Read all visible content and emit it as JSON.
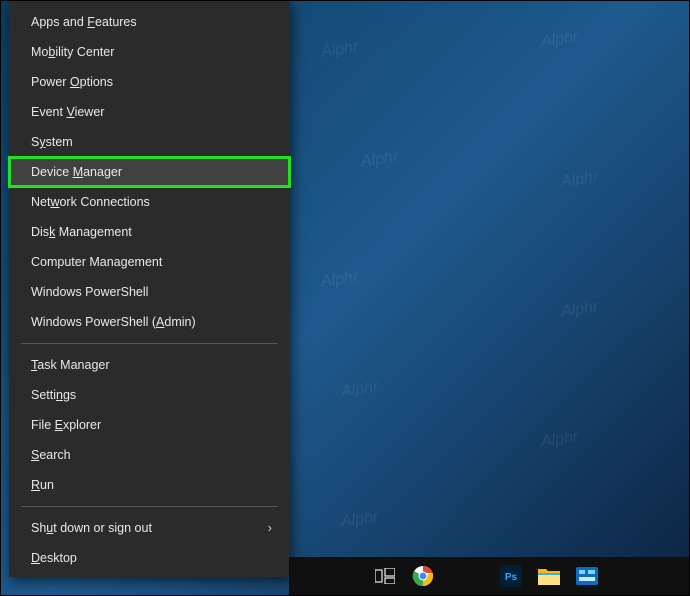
{
  "menu": {
    "items": [
      {
        "label": "Apps and Features",
        "underline": "F"
      },
      {
        "label": "Mobility Center",
        "underline": "b"
      },
      {
        "label": "Power Options",
        "underline": "O"
      },
      {
        "label": "Event Viewer",
        "underline": "V"
      },
      {
        "label": "System",
        "underline": "Y"
      },
      {
        "label": "Device Manager",
        "underline": "M",
        "highlighted": true,
        "hovered": true
      },
      {
        "label": "Network Connections",
        "underline": "W"
      },
      {
        "label": "Disk Management",
        "underline": "k"
      },
      {
        "label": "Computer Management",
        "underline": "G"
      },
      {
        "label": "Windows PowerShell",
        "underline": ""
      },
      {
        "label": "Windows PowerShell (Admin)",
        "underline": "A"
      }
    ],
    "items2": [
      {
        "label": "Task Manager",
        "underline": "T"
      },
      {
        "label": "Settings",
        "underline": "N"
      },
      {
        "label": "File Explorer",
        "underline": "E"
      },
      {
        "label": "Search",
        "underline": "S"
      },
      {
        "label": "Run",
        "underline": "R"
      }
    ],
    "items3": [
      {
        "label": "Shut down or sign out",
        "underline": "U",
        "submenu": true
      },
      {
        "label": "Desktop",
        "underline": "D"
      }
    ]
  },
  "taskbar": {
    "icons": [
      "task-view",
      "chrome",
      "photoshop",
      "file-explorer",
      "control-panel"
    ]
  }
}
